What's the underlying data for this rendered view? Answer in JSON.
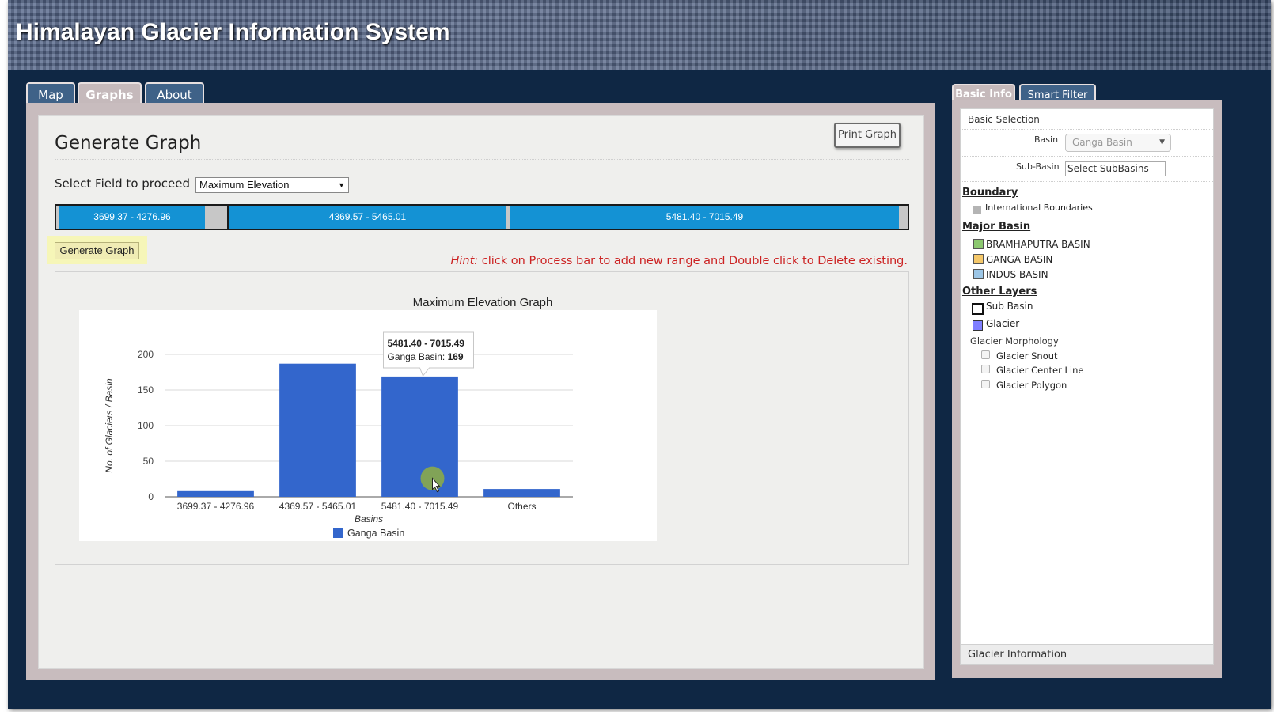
{
  "header": {
    "title": "Himalayan Glacier Information System"
  },
  "main_tabs": [
    {
      "label": "Map",
      "active": false
    },
    {
      "label": "Graphs",
      "active": true
    },
    {
      "label": "About",
      "active": false
    }
  ],
  "side_tabs": [
    {
      "label": "Basic Info",
      "active": true
    },
    {
      "label": "Smart Filter",
      "active": false
    }
  ],
  "graph_panel": {
    "title": "Generate Graph",
    "print_button": "Print Graph",
    "field_label": "Select Field to proceed :",
    "field_value": "Maximum Elevation",
    "ranges": [
      "3699.37 - 4276.96",
      "4369.57 - 5465.01",
      "5481.40 - 7015.49"
    ],
    "generate_button": "Generate Graph",
    "hint_prefix": "Hint:",
    "hint_text": " click on Process bar to add new range and Double click to Delete existing."
  },
  "chart_data": {
    "type": "bar",
    "title": "Maximum Elevation Graph",
    "xlabel": "Basins",
    "ylabel": "No. of Glaciers / Basin",
    "categories": [
      "3699.37 - 4276.96",
      "4369.57 - 5465.01",
      "5481.40 - 7015.49",
      "Others"
    ],
    "series": [
      {
        "name": "Ganga Basin",
        "values": [
          8,
          187,
          169,
          11
        ],
        "color": "#3366cc"
      }
    ],
    "ylim": [
      0,
      200
    ],
    "yticks": [
      0,
      50,
      100,
      150,
      200
    ],
    "grid": true,
    "legend_position": "bottom",
    "tooltip": {
      "category": "5481.40 - 7015.49",
      "series": "Ganga Basin",
      "value": 169
    }
  },
  "sidebar": {
    "basic_selection": "Basic Selection",
    "basin_label": "Basin",
    "basin_value": "Ganga Basin",
    "subbasin_label": "Sub-Basin",
    "subbasin_value": "Select SubBasins",
    "boundary_heading": "Boundary",
    "boundary_item": "International Boundaries",
    "major_basin_heading": "Major Basin",
    "major_basins": [
      {
        "label": "BRAMHAPUTRA BASIN",
        "color": "#8cc870"
      },
      {
        "label": "GANGA BASIN",
        "color": "#f5c86a"
      },
      {
        "label": "INDUS BASIN",
        "color": "#9cc6e6"
      }
    ],
    "other_layers_heading": "Other Layers",
    "sub_basin_label": "Sub Basin",
    "glacier_label": "Glacier",
    "glacier_color": "#7f7fff",
    "morphology_heading": "Glacier Morphology",
    "morphology_items": [
      "Glacier Snout",
      "Glacier Center Line",
      "Glacier Polygon"
    ],
    "glacier_info": "Glacier Information"
  }
}
